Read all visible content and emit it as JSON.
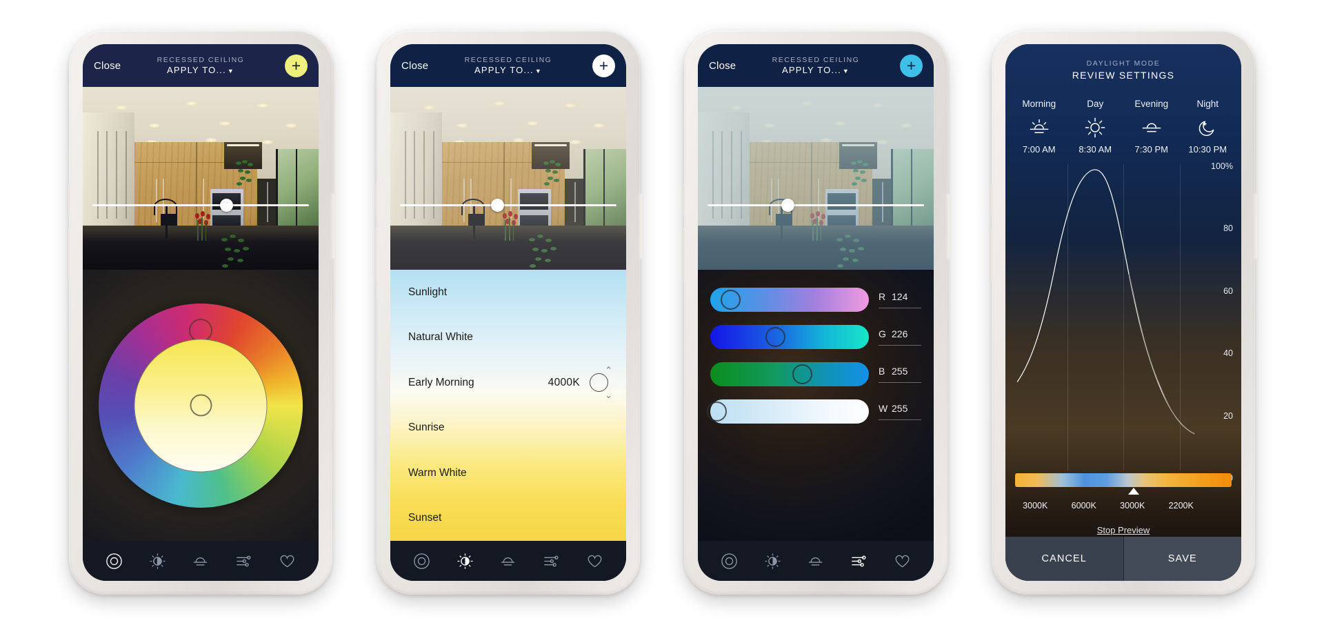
{
  "phones": [
    {
      "id": "color-wheel",
      "topbar": {
        "close": "Close",
        "subtitle": "RECESSED CEILING",
        "title": "APPLY TO...",
        "caret": "▼",
        "plus": "+",
        "plus_color": "#efef7e"
      },
      "brightness": {
        "value_pct": 62
      },
      "wheel": {
        "hue_handle_angle_deg": 0,
        "selected_color": "#f6e651"
      },
      "toolbar": {
        "active": "color-wheel",
        "items": [
          "color-wheel",
          "brightness",
          "sunset",
          "sliders",
          "favorite"
        ]
      }
    },
    {
      "id": "white-presets",
      "topbar": {
        "close": "Close",
        "subtitle": "RECESSED CEILING",
        "title": "APPLY TO...",
        "caret": "▼",
        "plus": "+",
        "plus_color": "#ffffff"
      },
      "brightness": {
        "value_pct": 45
      },
      "presets": [
        {
          "label": "Sunlight",
          "value": "",
          "selected": false
        },
        {
          "label": "Natural White",
          "value": "",
          "selected": false
        },
        {
          "label": "Early Morning",
          "value": "4000K",
          "selected": true
        },
        {
          "label": "Sunrise",
          "value": "",
          "selected": false
        },
        {
          "label": "Warm White",
          "value": "",
          "selected": false
        },
        {
          "label": "Sunset",
          "value": "",
          "selected": false
        }
      ],
      "stepper": {
        "up": "⌃",
        "down": "⌄"
      },
      "toolbar": {
        "active": "brightness",
        "items": [
          "color-wheel",
          "brightness",
          "sunset",
          "sliders",
          "favorite"
        ]
      }
    },
    {
      "id": "rgbw-sliders",
      "topbar": {
        "close": "Close",
        "subtitle": "RECESSED CEILING",
        "title": "APPLY TO...",
        "caret": "▼",
        "plus": "+",
        "plus_color": "#3dbfe8"
      },
      "brightness": {
        "value_pct": 37
      },
      "channels": [
        {
          "label": "R",
          "value": "124",
          "pct": 13
        },
        {
          "label": "G",
          "value": "226",
          "pct": 41
        },
        {
          "label": "B",
          "value": "255",
          "pct": 58
        },
        {
          "label": "W",
          "value": "255",
          "pct": 3
        }
      ],
      "toolbar": {
        "active": "sliders",
        "items": [
          "color-wheel",
          "brightness",
          "sunset",
          "sliders",
          "favorite"
        ]
      }
    },
    {
      "id": "daylight-mode",
      "header": {
        "eyebrow": "DAYLIGHT MODE",
        "title": "REVIEW SETTINGS"
      },
      "schedule": [
        {
          "name": "Morning",
          "icon": "sunrise-icon",
          "time": "7:00 AM"
        },
        {
          "name": "Day",
          "icon": "sun-icon",
          "time": "8:30 AM"
        },
        {
          "name": "Evening",
          "icon": "sunset-icon",
          "time": "7:30 PM"
        },
        {
          "name": "Night",
          "icon": "moon-icon",
          "time": "10:30 PM"
        }
      ],
      "stop_preview": "Stop Preview",
      "actions": {
        "cancel": "CANCEL",
        "save": "SAVE"
      }
    }
  ],
  "chart_data": {
    "type": "line",
    "title": "",
    "xlabel": "",
    "ylabel": "",
    "ylim": [
      0,
      100
    ],
    "y_ticks": [
      "100%",
      "80",
      "60",
      "40",
      "20",
      "0"
    ],
    "x_ticks": [
      "3000K",
      "6000K",
      "3000K",
      "2200K"
    ],
    "grid": true,
    "legend": "none",
    "marker_label": "3000K",
    "series": [
      {
        "name": "brightness",
        "x": [
          0,
          8,
          16,
          24,
          32,
          40,
          48,
          56,
          64,
          72,
          80,
          88,
          96,
          100
        ],
        "values": [
          29,
          40,
          56,
          74,
          90,
          99,
          100,
          95,
          84,
          68,
          52,
          37,
          24,
          14
        ]
      }
    ]
  }
}
